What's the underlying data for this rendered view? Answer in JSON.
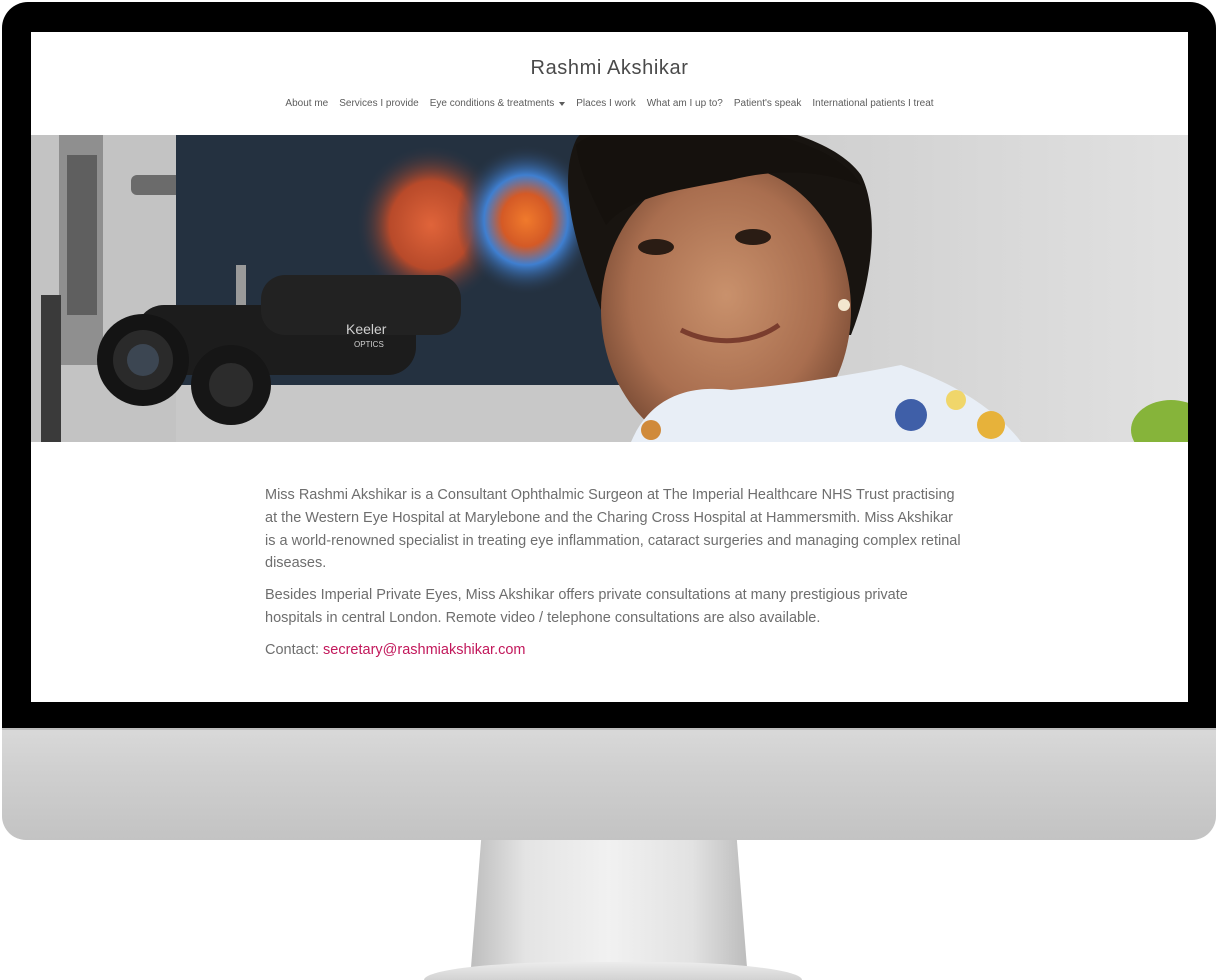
{
  "site": {
    "title": "Rashmi Akshikar"
  },
  "nav": {
    "items": [
      {
        "label": "About me"
      },
      {
        "label": "Services I provide"
      },
      {
        "label": "Eye conditions & treatments",
        "has_dropdown": true
      },
      {
        "label": "Places I work"
      },
      {
        "label": "What am I up to?"
      },
      {
        "label": "Patient's speak"
      },
      {
        "label": "International patients I treat"
      }
    ]
  },
  "hero": {
    "image_alt": "Photo of a woman at an eye examination slit lamp",
    "device_brand_line1": "Keeler",
    "device_brand_line2": "OPTICS"
  },
  "content": {
    "paragraph1": "Miss Rashmi Akshikar is a Consultant Ophthalmic Surgeon at The Imperial Healthcare NHS Trust practising at the Western Eye Hospital at Marylebone and the Charing Cross Hospital at Hammersmith. Miss Akshikar is a world-renowned specialist in treating eye inflammation, cataract surgeries and managing complex retinal diseases.",
    "paragraph2": "Besides Imperial Private Eyes, Miss Akshikar offers private consultations at many prestigious private hospitals in central London. Remote video / telephone consultations are also available.",
    "contact_label": "Contact:",
    "contact_email": "secretary@rashmiakshikar.com"
  },
  "colors": {
    "link": "#c2185b",
    "body_text": "#6e6e6e",
    "nav_text": "#5c5c5c",
    "monitor_bezel": "#000000",
    "monitor_chin": "#cfcfcf"
  }
}
